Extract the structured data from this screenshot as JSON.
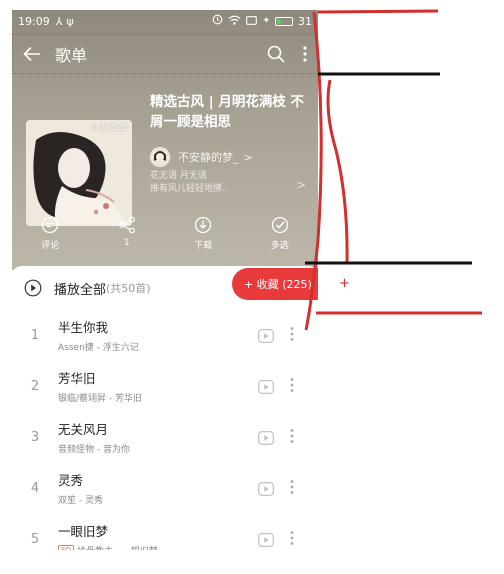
{
  "status_bar": {
    "time": "19:09",
    "battery": "31",
    "battery_level": 0.31
  },
  "header": {
    "title": "歌单"
  },
  "playlist": {
    "play_count": "▷27523",
    "title": "精选古风 | 月明花满枝 不屑一顾是相思",
    "creator": "不安静的梦_",
    "creator_chevron": ">",
    "desc_line1": "花无语 月无语",
    "desc_line2": "推有风儿轻轻地拂..",
    "desc_chevron": ">"
  },
  "actions": [
    {
      "label": "评论",
      "icon": "comment-icon"
    },
    {
      "label": "1",
      "icon": "share-icon"
    },
    {
      "label": "下载",
      "icon": "download-icon"
    },
    {
      "label": "多选",
      "icon": "multiselect-icon"
    }
  ],
  "list": {
    "play_all_label": "播放全部",
    "play_all_count": "(共50首)",
    "collect_label": "+ 收藏 (225)",
    "songs": [
      {
        "index": "1",
        "name": "半生你我",
        "artist": "Assen捷 - 浮生六记",
        "sq": ""
      },
      {
        "index": "2",
        "name": "芳华旧",
        "artist": "银临/蔡翊昇 - 芳华旧",
        "sq": ""
      },
      {
        "index": "3",
        "name": "无关风月",
        "artist": "音频怪物 - 音为你",
        "sq": ""
      },
      {
        "index": "4",
        "name": "灵秀",
        "artist": "双笙 - 灵秀",
        "sq": ""
      },
      {
        "index": "5",
        "name": "一眼旧梦",
        "artist": "排骨教主 - 一眼旧梦",
        "sq": "SQ"
      }
    ]
  },
  "annotation": {
    "plus": "+"
  },
  "colors": {
    "accent": "#e83a3a",
    "hero": "#a59f92",
    "annotation_red": "#d03030"
  }
}
